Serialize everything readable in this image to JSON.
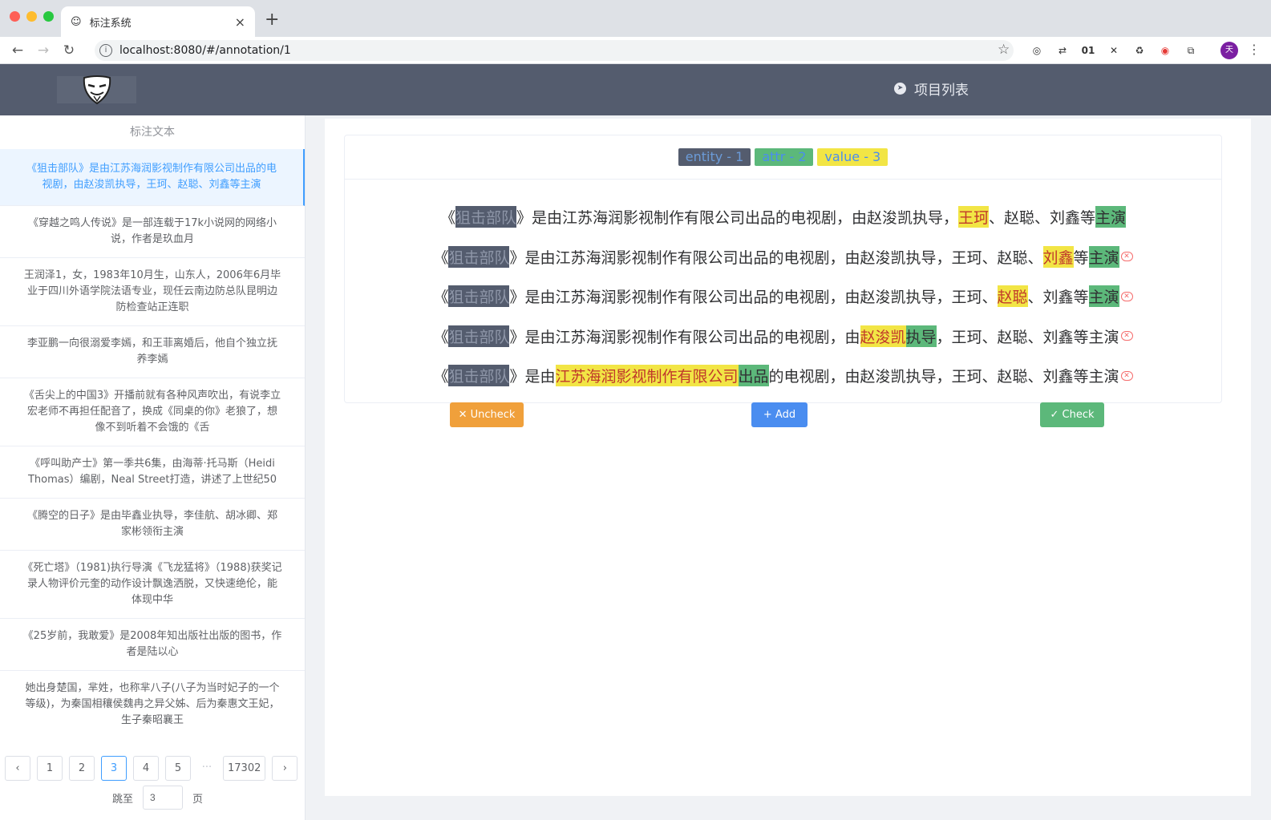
{
  "browser": {
    "tab_title": "标注系统",
    "url": "localhost:8080/#/annotation/1",
    "profile_initial": "天",
    "extensions": [
      "◎",
      "⇄",
      "01",
      "✕",
      "♻",
      "◉",
      "⧉"
    ]
  },
  "header": {
    "nav_label": "项目列表"
  },
  "sidebar": {
    "title": "标注文本",
    "items": [
      "《狙击部队》是由江苏海润影视制作有限公司出品的电视剧，由赵浚凯执导，王珂、赵聪、刘鑫等主演",
      "《穿越之鸣人传说》是一部连载于17k小说网的网络小说，作者是玖血月",
      "王润泽1，女，1983年10月生，山东人，2006年6月毕业于四川外语学院法语专业，现任云南边防总队昆明边防检查站正连职",
      "李亚鹏一向很溺爱李嫣，和王菲离婚后，他自个独立抚养李嫣",
      "《舌尖上的中国3》开播前就有各种风声吹出，有说李立宏老师不再担任配音了，换成《同桌的你》老狼了，想像不到听着不会饿的《舌",
      "《呼叫助产士》第一季共6集，由海蒂·托马斯（Heidi Thomas）编剧，Neal Street打造，讲述了上世纪50",
      "《腾空的日子》是由毕鑫业执导，李佳航、胡冰卿、郑家彬领衔主演",
      "《死亡塔》（1981)执行导演《飞龙猛将》（1988)获奖记录人物评价元奎的动作设计飘逸洒脱，又快速绝伦，能体现中华",
      "《25岁前，我敢爱》是2008年知出版社出版的图书，作者是陆以心",
      "她出身楚国，芈姓，也称芈八子(八子为当时妃子的一个等级)，为秦国相穰侯魏冉之异父姊、后为秦惠文王妃，生子秦昭襄王"
    ]
  },
  "pagination": {
    "prev": "‹",
    "next": "›",
    "pages": [
      "1",
      "2",
      "3",
      "4",
      "5"
    ],
    "current": "3",
    "ellipsis": "···",
    "last": "17302",
    "jump_label": "跳至",
    "jump_value": "3",
    "page_suffix": "页"
  },
  "tags": {
    "entity": "entity - 1",
    "attr": "attr - 2",
    "value": "value - 3"
  },
  "lines": [
    [
      [
        "《"
      ],
      [
        "狙击部队",
        "e"
      ],
      [
        "》是由江苏海润影视制作有限公司出品的电视剧，由赵浚凯执导，"
      ],
      [
        "王珂",
        "v"
      ],
      [
        "、赵聪、刘鑫等"
      ],
      [
        "主演",
        "a"
      ]
    ],
    [
      [
        "《"
      ],
      [
        "狙击部队",
        "e"
      ],
      [
        "》是由江苏海润影视制作有限公司出品的电视剧，由赵浚凯执导，王珂、赵聪、"
      ],
      [
        "刘鑫",
        "v"
      ],
      [
        "等"
      ],
      [
        "主演",
        "a"
      ],
      [
        "✕",
        "d"
      ]
    ],
    [
      [
        "《"
      ],
      [
        "狙击部队",
        "e"
      ],
      [
        "》是由江苏海润影视制作有限公司出品的电视剧，由赵浚凯执导，王珂、"
      ],
      [
        "赵聪",
        "v"
      ],
      [
        "、刘鑫等"
      ],
      [
        "主演",
        "a"
      ],
      [
        "✕",
        "d"
      ]
    ],
    [
      [
        "《"
      ],
      [
        "狙击部队",
        "e"
      ],
      [
        "》是由江苏海润影视制作有限公司出品的电视剧，由"
      ],
      [
        "赵浚凯",
        "v"
      ],
      [
        "执导",
        "a"
      ],
      [
        "，王珂、赵聪、刘鑫等主演"
      ],
      [
        "✕",
        "d"
      ]
    ],
    [
      [
        "《"
      ],
      [
        "狙击部队",
        "e"
      ],
      [
        "》是由"
      ],
      [
        "江苏海润影视制作有限公司",
        "v"
      ],
      [
        "出品",
        "a"
      ],
      [
        "的电视剧，由赵浚凯执导，王珂、赵聪、刘鑫等主演"
      ],
      [
        "✕",
        "d"
      ]
    ]
  ],
  "buttons": {
    "uncheck": "✕ Uncheck",
    "add": "+ Add",
    "check": "✓ Check"
  },
  "colors": {
    "header": "#545c6e",
    "uncheck": "#f0a03b",
    "add": "#4a8df0",
    "check": "#5cb87a",
    "entity": "#545c6e",
    "attr": "#5cb87a",
    "value": "#f2e545"
  }
}
